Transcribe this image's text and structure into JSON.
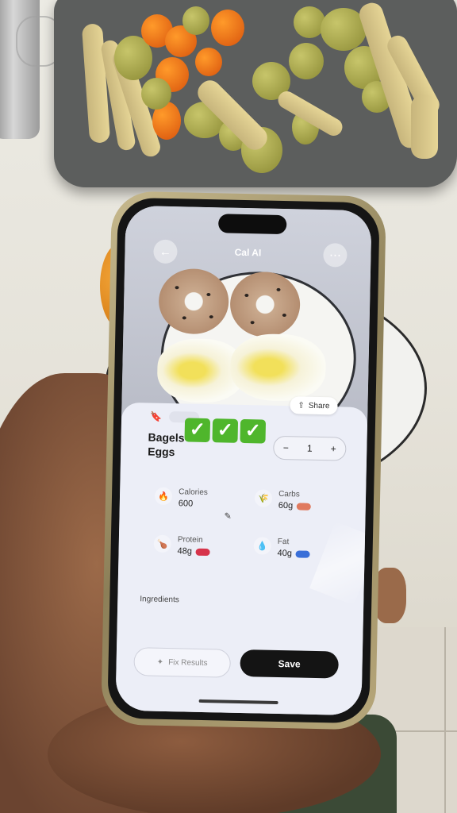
{
  "app": {
    "title": "Cal AI",
    "back_icon": "arrow-left-icon",
    "menu_icon": "more-horizontal-icon"
  },
  "photo_card": {
    "share_label": "Share",
    "share_icon": "share-icon",
    "bookmark_icon": "bookmark-icon",
    "food_name_line1": "Bagels",
    "food_name_line2": "Eggs",
    "check_emojis": [
      "✓",
      "✓",
      "✓"
    ],
    "quantity": {
      "minus": "−",
      "value": "1",
      "plus": "+"
    }
  },
  "macros": {
    "calories": {
      "label": "Calories",
      "value": "600",
      "icon": "flame-icon"
    },
    "carbs": {
      "label": "Carbs",
      "value": "60g",
      "icon": "wheat-icon",
      "badge_color": "#e07a5f"
    },
    "protein": {
      "label": "Protein",
      "value": "48g",
      "icon": "drumstick-icon",
      "badge_color": "#d6334a"
    },
    "fat": {
      "label": "Fat",
      "value": "40g",
      "icon": "droplet-icon",
      "badge_color": "#3a6fd8"
    }
  },
  "ingredients": {
    "title": "Ingredients"
  },
  "actions": {
    "fix_label": "Fix Results",
    "fix_icon": "sparkle-icon",
    "save_label": "Save"
  },
  "colors": {
    "check_green": "#4fb62c",
    "save_button": "#141414",
    "sheet_bg": "#eceef7"
  }
}
